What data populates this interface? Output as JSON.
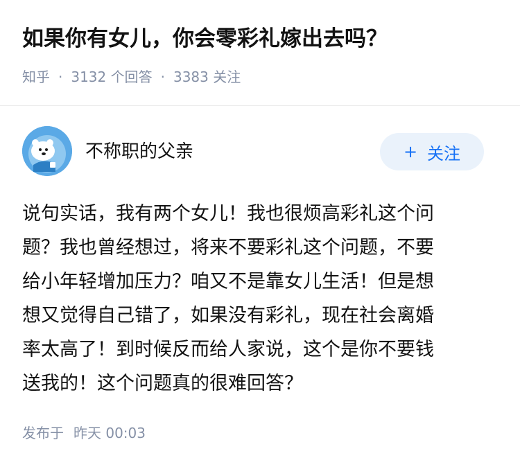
{
  "question": {
    "title": "如果你有女儿，你会零彩礼嫁出去吗？",
    "source": "知乎",
    "answers_count": "3132",
    "answers_label": "个回答",
    "followers_count": "3383",
    "followers_label": "关注"
  },
  "author": {
    "name": "不称职的父亲",
    "follow_label": "关注",
    "follow_icon": "plus-icon"
  },
  "answer": {
    "lines": [
      "说句实话，我有两个女儿！我也很烦高彩礼这个问",
      "题？我也曾经想过，将来不要彩礼这个问题，不要",
      "给小年轻增加压力？咱又不是靠女儿生活！但是想",
      "想又觉得自己错了，如果没有彩礼，现在社会离婚",
      "率太高了！到时候反而给人家说，这个是你不要钱",
      "送我的！这个问题真的很难回答？"
    ],
    "published_prefix": "发布于",
    "published_time": "昨天 00:03"
  },
  "colors": {
    "accent": "#1772f6",
    "follow_bg": "#eaf2fb",
    "meta_gray": "#8590a6",
    "avatar_bg": "#5aa9e6"
  }
}
